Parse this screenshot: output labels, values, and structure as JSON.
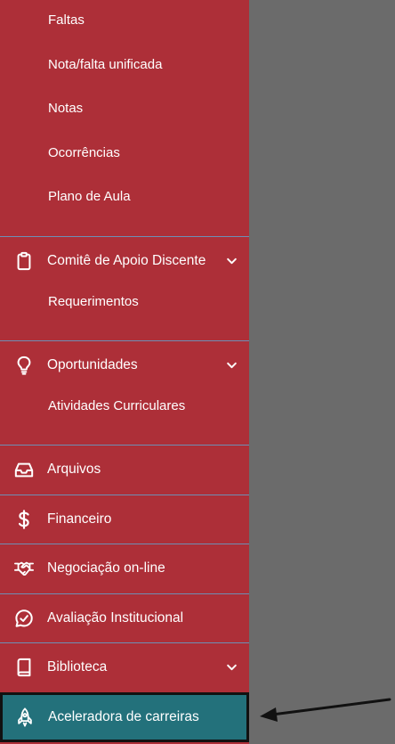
{
  "sidebar": {
    "sub_items_top": [
      "Faltas",
      "Nota/falta unificada",
      "Notas",
      "Ocorrências",
      "Plano de Aula"
    ],
    "comite": {
      "label": "Comitê de Apoio Discente",
      "icon": "clipboard-icon",
      "sub_items": [
        "Requerimentos"
      ]
    },
    "oportunidades": {
      "label": "Oportunidades",
      "icon": "lightbulb-icon",
      "sub_items": [
        "Atividades Curriculares"
      ]
    },
    "arquivos": {
      "label": "Arquivos",
      "icon": "inbox-tray-icon"
    },
    "financeiro": {
      "label": "Financeiro",
      "icon": "dollar-icon"
    },
    "negociacao": {
      "label": "Negociação on-line",
      "icon": "handshake-icon"
    },
    "avaliacao": {
      "label": "Avaliação Institucional",
      "icon": "chat-check-icon"
    },
    "biblioteca": {
      "label": "Biblioteca",
      "icon": "book-icon"
    },
    "aceleradora": {
      "label": "Aceleradora de carreiras",
      "icon": "rocket-icon"
    }
  },
  "colors": {
    "sidebar_bg": "#ad2f38",
    "active_bg": "#23717b",
    "divider": "#6d8fb5",
    "backdrop": "#6b6b6b",
    "annotation_arrow": "#111111"
  }
}
